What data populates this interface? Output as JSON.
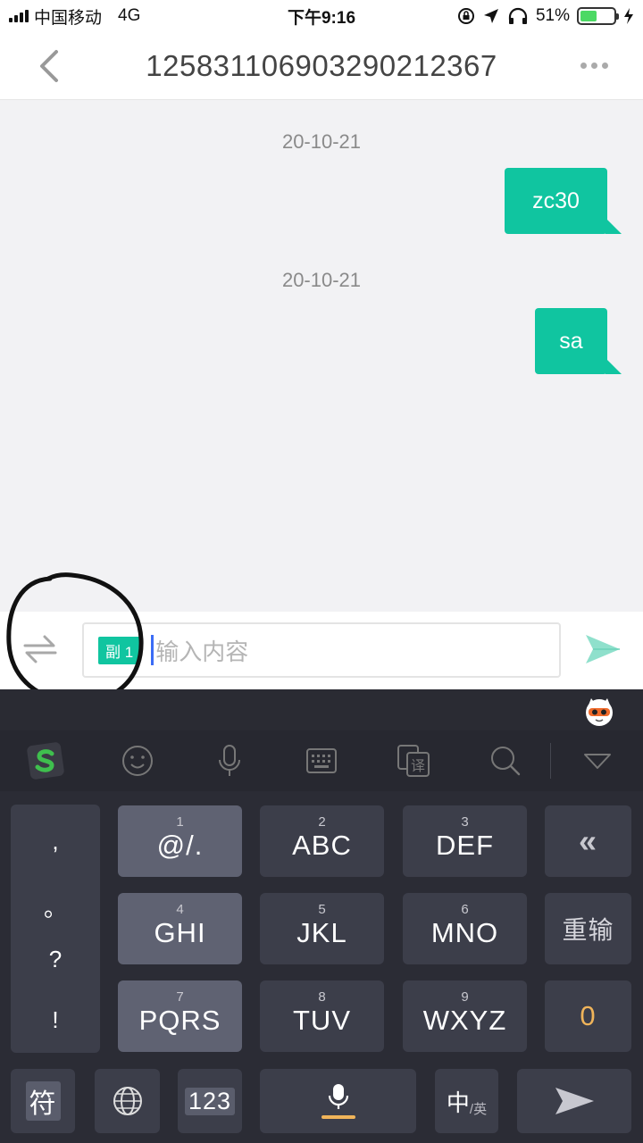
{
  "status_bar": {
    "carrier": "中国移动",
    "network": "4G",
    "time": "下午9:16",
    "battery": "51%",
    "battery_level": 0.51
  },
  "header": {
    "title": "125831106903290212367"
  },
  "messages": [
    {
      "timestamp": "20-10-21",
      "text": "zc30"
    },
    {
      "timestamp": "20-10-21",
      "text": "sa"
    }
  ],
  "input": {
    "sim_badge": "副 1",
    "placeholder": "输入内容"
  },
  "keyboard": {
    "punctuation": [
      ",",
      "。",
      "?",
      "!"
    ],
    "keys": [
      {
        "num": "1",
        "label": "@/."
      },
      {
        "num": "2",
        "label": "ABC"
      },
      {
        "num": "3",
        "label": "DEF"
      },
      {
        "num": "4",
        "label": "GHI"
      },
      {
        "num": "5",
        "label": "JKL"
      },
      {
        "num": "6",
        "label": "MNO"
      },
      {
        "num": "7",
        "label": "PQRS"
      },
      {
        "num": "8",
        "label": "TUV"
      },
      {
        "num": "9",
        "label": "WXYZ"
      }
    ],
    "delete_label": "«",
    "retype_label": "重输",
    "zero_label": "0",
    "symbol_label": "符",
    "numbers_label": "123",
    "lang_main": "中",
    "lang_sub": "/英"
  },
  "colors": {
    "accent": "#10c5a0",
    "keyboard_bg": "#2b2c35",
    "orange": "#f0b45a"
  }
}
